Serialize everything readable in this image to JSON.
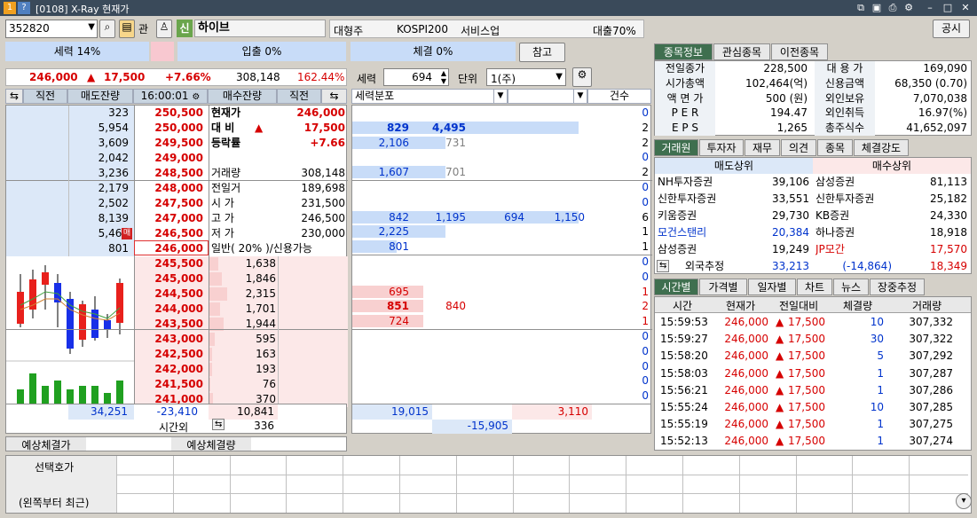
{
  "window": {
    "badge1": "1",
    "badge2": "?",
    "title": "[0108] X-Ray 현재가"
  },
  "toolbar": {
    "code": "352820",
    "gwan_label": "관",
    "shin_label": "신",
    "stock_name": "하이브",
    "category": "대형주",
    "index": "KOSPI200",
    "sector": "서비스업",
    "loan_ratio": "대출70%",
    "notice_button": "공시",
    "ref_button": "참고"
  },
  "power": {
    "force": "세력 14%",
    "inflow": "입출 0%",
    "contract": "체결 0%"
  },
  "price_line": {
    "price": "246,000",
    "arrow": "▲",
    "change": "17,500",
    "rate": "+7.66%",
    "volume": "308,148",
    "vol_rate": "162.44%"
  },
  "controls": {
    "force_label": "세력",
    "force_value": "694",
    "unit_label": "단위",
    "unit_value": "1(주)"
  },
  "orderbook": {
    "headers": {
      "prev_left": "직전",
      "sell_remain": "매도잔량",
      "time": "16:00:01",
      "buy_remain": "매수잔량",
      "prev_right": "직전"
    },
    "asks": [
      {
        "qty": "323",
        "price": "250,500"
      },
      {
        "qty": "5,954",
        "price": "250,000"
      },
      {
        "qty": "3,609",
        "price": "249,500"
      },
      {
        "qty": "2,042",
        "price": "249,000"
      },
      {
        "qty": "3,236",
        "price": "248,500"
      },
      {
        "qty": "2,179",
        "price": "248,000"
      },
      {
        "qty": "2,502",
        "price": "247,500"
      },
      {
        "qty": "8,139",
        "price": "247,000"
      },
      {
        "qty": "5,466",
        "price": "246,500",
        "marker": "매"
      },
      {
        "qty": "801",
        "price": "246,000"
      }
    ],
    "bids": [
      {
        "price": "245,500",
        "qty": "1,638"
      },
      {
        "price": "245,000",
        "qty": "1,846"
      },
      {
        "price": "244,500",
        "qty": "2,315"
      },
      {
        "price": "244,000",
        "qty": "1,701"
      },
      {
        "price": "243,500",
        "qty": "1,944"
      },
      {
        "price": "243,000",
        "qty": "595"
      },
      {
        "price": "242,500",
        "qty": "163"
      },
      {
        "price": "242,000",
        "qty": "193"
      },
      {
        "price": "241,500",
        "qty": "76"
      },
      {
        "price": "241,000",
        "qty": "370"
      }
    ],
    "totals": {
      "ask_total": "34,251",
      "diff": "-23,410",
      "bid_total": "10,841",
      "after_label": "시간외",
      "after_value": "336"
    },
    "info": [
      {
        "label": "현재가",
        "value": "246,000"
      },
      {
        "label": "대 비",
        "arrow": "▲",
        "value": "17,500"
      },
      {
        "label": "등락률",
        "value": "+7.66"
      },
      {
        "label": "",
        "value": ""
      },
      {
        "label": "거래량",
        "value": "308,148"
      },
      {
        "label": "전일거",
        "value": "189,698"
      },
      {
        "label": "시 가",
        "value": "231,500"
      },
      {
        "label": "고 가",
        "value": "246,500"
      },
      {
        "label": "저 가",
        "value": "230,000"
      },
      {
        "label": "일반( 20% )/신용가능",
        "value": ""
      }
    ],
    "expected": {
      "price_label": "예상체결가",
      "qty_label": "예상체결량"
    }
  },
  "distribution": {
    "headers": {
      "dist": "세력분포",
      "count": "건수"
    },
    "rows": [
      {
        "a": "",
        "b": "",
        "c": "",
        "d": "",
        "n": "0"
      },
      {
        "a": "829",
        "b": "4,495",
        "c": "",
        "d": "",
        "n": "2"
      },
      {
        "a": "2,106",
        "b": "731",
        "c": "",
        "d": "",
        "n": "2"
      },
      {
        "a": "",
        "b": "",
        "c": "",
        "d": "",
        "n": "0"
      },
      {
        "a": "1,607",
        "b": "701",
        "c": "",
        "d": "",
        "n": "2"
      },
      {
        "a": "",
        "b": "",
        "c": "",
        "d": "",
        "n": "0"
      },
      {
        "a": "",
        "b": "",
        "c": "",
        "d": "",
        "n": "0"
      },
      {
        "a": "842",
        "b": "1,195",
        "c": "694",
        "d": "1,150",
        "n": "6"
      },
      {
        "a": "2,225",
        "b": "",
        "c": "",
        "d": "",
        "n": "1"
      },
      {
        "a": "801",
        "b": "",
        "c": "",
        "d": "",
        "n": "1"
      },
      {
        "a": "",
        "b": "",
        "c": "",
        "d": "",
        "n": "0"
      },
      {
        "a": "",
        "b": "",
        "c": "",
        "d": "",
        "n": "0"
      },
      {
        "a": "695",
        "b": "",
        "c": "",
        "d": "",
        "n": "1"
      },
      {
        "a": "851",
        "b": "840",
        "c": "",
        "d": "",
        "n": "2"
      },
      {
        "a": "724",
        "b": "",
        "c": "",
        "d": "",
        "n": "1"
      },
      {
        "a": "",
        "b": "",
        "c": "",
        "d": "",
        "n": "0"
      },
      {
        "a": "",
        "b": "",
        "c": "",
        "d": "",
        "n": "0"
      },
      {
        "a": "",
        "b": "",
        "c": "",
        "d": "",
        "n": "0"
      },
      {
        "a": "",
        "b": "",
        "c": "",
        "d": "",
        "n": "0"
      },
      {
        "a": "",
        "b": "",
        "c": "",
        "d": "",
        "n": "0"
      }
    ],
    "totals": {
      "left": "19,015",
      "right": "3,110",
      "net": "-15,905"
    }
  },
  "stockinfo": {
    "tabs": [
      "종목정보",
      "관심종목",
      "이전종목"
    ],
    "rows": [
      {
        "l1": "전일종가",
        "v1": "228,500",
        "l2": "대 용 가",
        "v2": "169,090"
      },
      {
        "l1": "시가총액",
        "v1": "102,464(억)",
        "l2": "신용금액",
        "v2": "68,350   (0.70)"
      },
      {
        "l1": "액 면 가",
        "v1": "500 (원)",
        "l2": "외인보유",
        "v2": "7,070,038"
      },
      {
        "l1": "P E R",
        "v1": "194.47",
        "l2": "외인취득",
        "v2": "16.97(%)"
      },
      {
        "l1": "E P S",
        "v1": "1,265",
        "l2": "총주식수",
        "v2": "41,652,097"
      }
    ]
  },
  "brokers": {
    "tabs": [
      "거래원",
      "투자자",
      "재무",
      "의견",
      "종목",
      "체결강도"
    ],
    "sell_header": "매도상위",
    "buy_header": "매수상위",
    "rows": [
      {
        "sname": "NH투자증권",
        "sqty": "39,106",
        "bname": "삼성증권",
        "bqty": "81,113"
      },
      {
        "sname": "신한투자증권",
        "sqty": "33,551",
        "bname": "신한투자증권",
        "bqty": "25,182"
      },
      {
        "sname": "키움증권",
        "sqty": "29,730",
        "bname": "KB증권",
        "bqty": "24,330"
      },
      {
        "sname": "모건스탠리",
        "sqty": "20,384",
        "bname": "하나증권",
        "bqty": "18,918"
      },
      {
        "sname": "삼성증권",
        "sqty": "19,249",
        "bname": "JP모간",
        "bqty": "17,570"
      }
    ],
    "foreign": {
      "label": "외국추정",
      "sell": "33,213",
      "diff": "(-14,864)",
      "buy": "18,349"
    }
  },
  "trades": {
    "tabs": [
      "시간별",
      "가격별",
      "일자별",
      "차트",
      "뉴스",
      "장중추정"
    ],
    "headers": [
      "시간",
      "현재가",
      "전일대비",
      "체결량",
      "거래량"
    ],
    "rows": [
      {
        "time": "15:59:53",
        "price": "246,000",
        "change": "17,500",
        "qty": "10",
        "vol": "307,332"
      },
      {
        "time": "15:59:27",
        "price": "246,000",
        "change": "17,500",
        "qty": "30",
        "vol": "307,322"
      },
      {
        "time": "15:58:20",
        "price": "246,000",
        "change": "17,500",
        "qty": "5",
        "vol": "307,292"
      },
      {
        "time": "15:58:03",
        "price": "246,000",
        "change": "17,500",
        "qty": "1",
        "vol": "307,287"
      },
      {
        "time": "15:56:21",
        "price": "246,000",
        "change": "17,500",
        "qty": "1",
        "vol": "307,286"
      },
      {
        "time": "15:55:24",
        "price": "246,000",
        "change": "17,500",
        "qty": "10",
        "vol": "307,285"
      },
      {
        "time": "15:55:19",
        "price": "246,000",
        "change": "17,500",
        "qty": "1",
        "vol": "307,275"
      },
      {
        "time": "15:52:13",
        "price": "246,000",
        "change": "17,500",
        "qty": "1",
        "vol": "307,274"
      }
    ]
  },
  "bottom": {
    "label1": "선택호가",
    "label2": "(왼쪽부터 최근)"
  },
  "colors": {
    "ask_bg": "#dce8f8",
    "bid_bg": "#fce8e8",
    "tab_active": "#3f6f4f"
  }
}
